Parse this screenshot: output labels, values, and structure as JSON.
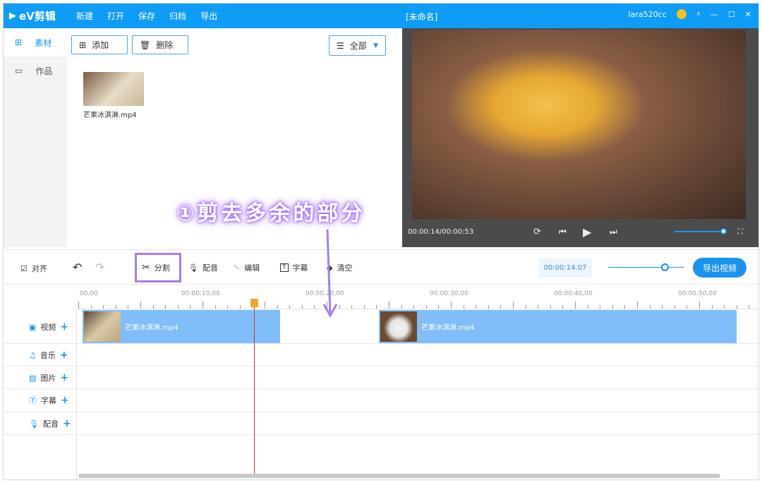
{
  "titlebar": {
    "logo": "eV剪辑",
    "menu": [
      "新建",
      "打开",
      "保存",
      "归档",
      "导出"
    ],
    "title": "[未命名]",
    "user": "lara520cc"
  },
  "sidebar": {
    "items": [
      {
        "label": "素材",
        "icon": "grid-icon"
      },
      {
        "label": "作品",
        "icon": "folder-icon"
      }
    ]
  },
  "media": {
    "add": "添加",
    "delete": "删除",
    "filter": "全部",
    "files": [
      {
        "name": "芒果冰淇淋.mp4"
      }
    ]
  },
  "preview": {
    "time": "00:00:14/00:00:53",
    "volume": 0.9
  },
  "toolbar": {
    "align": "对齐",
    "split": "分割",
    "dub": "配音",
    "edit": "编辑",
    "subtitle": "字幕",
    "clear": "清空",
    "current_time": "00:00:14.07",
    "zoom": 0.75,
    "export": "导出视频"
  },
  "ruler": {
    "labels": [
      "00,00",
      "00:00:10,00",
      "00:00:20,00",
      "00:00:30,00",
      "00:00:40,00",
      "00:00:50,00"
    ]
  },
  "tracks": [
    {
      "label": "视频"
    },
    {
      "label": "音乐"
    },
    {
      "label": "图片"
    },
    {
      "label": "字幕"
    },
    {
      "label": "配音"
    }
  ],
  "clips": [
    {
      "name": "芒果冰淇淋.mp4"
    },
    {
      "name": "芒果冰淇淋.mp4"
    }
  ],
  "annotation": "①剪去多余的部分",
  "colors": {
    "accent": "#0e9cf6",
    "highlight": "#a77de7",
    "playhead": "#d0312d"
  }
}
